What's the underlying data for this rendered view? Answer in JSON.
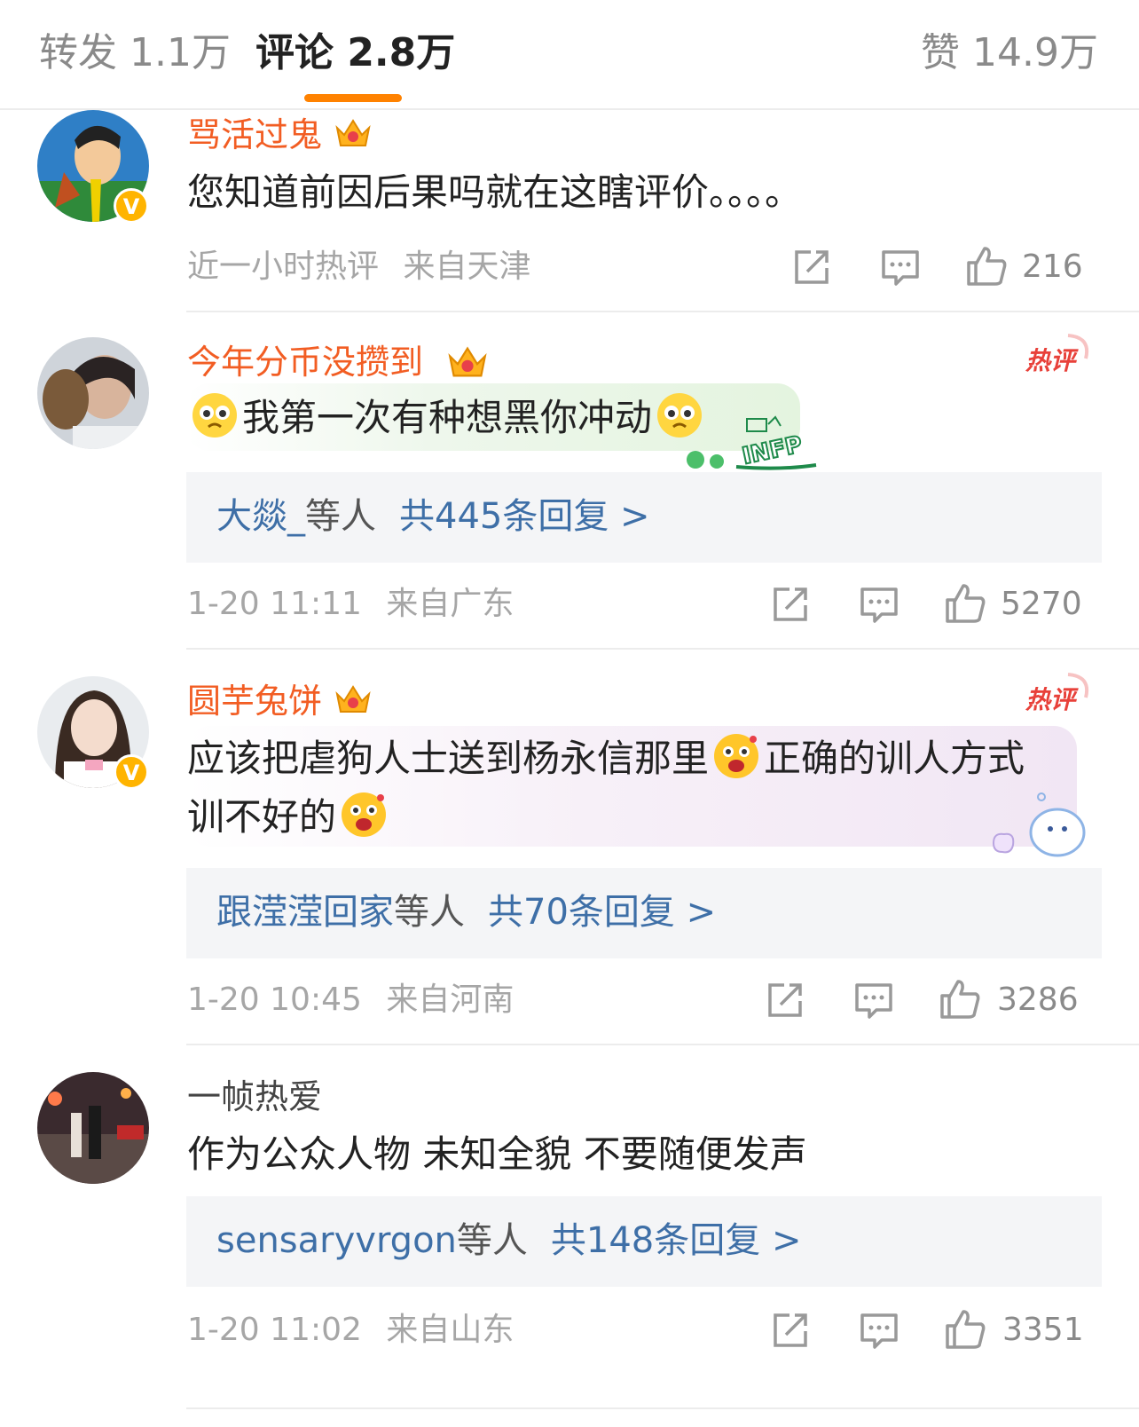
{
  "tabs": {
    "repost": "转发 1.1万",
    "comment": "评论 2.8万",
    "like": "赞 14.9万"
  },
  "colors": {
    "accent": "#ff8200",
    "username": "#f25d23",
    "reply_link": "#3e6fa7",
    "reply_bg": "#f4f5f7"
  },
  "comments": [
    {
      "username": "骂活过鬼",
      "verified": true,
      "text": "您知道前因后果吗就在这瞎评价。。。。",
      "time": "近一小时热评",
      "location": "来自天津",
      "likes": "216",
      "replies": null
    },
    {
      "username": "今年分币没攒到",
      "verified": false,
      "hot_badge": "热评",
      "text_parts": [
        "我第一次有种想黑你冲动"
      ],
      "emoji": "pleading-face",
      "bubble_tag": "INFP",
      "replies": {
        "who": "大燚_",
        "tail": "等人",
        "total": "共445条回复 >"
      },
      "time": "1-20 11:11",
      "location": "来自广东",
      "likes": "5270"
    },
    {
      "username": "圆芋兔饼",
      "verified": true,
      "hot_badge": "热评",
      "text_parts": [
        "应该把虐狗人士送到杨永信那里",
        "正确的训人方式",
        "训不好的"
      ],
      "emoji": "excited-face",
      "replies": {
        "who": "跟滢滢回家",
        "tail": "等人",
        "total": "共70条回复 >"
      },
      "time": "1-20 10:45",
      "location": "来自河南",
      "likes": "3286"
    },
    {
      "username": "一帧热爱",
      "verified": false,
      "text": "作为公众人物 未知全貌 不要随便发声",
      "replies": {
        "who": "sensaryvrgon",
        "tail": "等人",
        "total": "共148条回复 >"
      },
      "time": "1-20 11:02",
      "location": "来自山东",
      "likes": "3351"
    }
  ]
}
